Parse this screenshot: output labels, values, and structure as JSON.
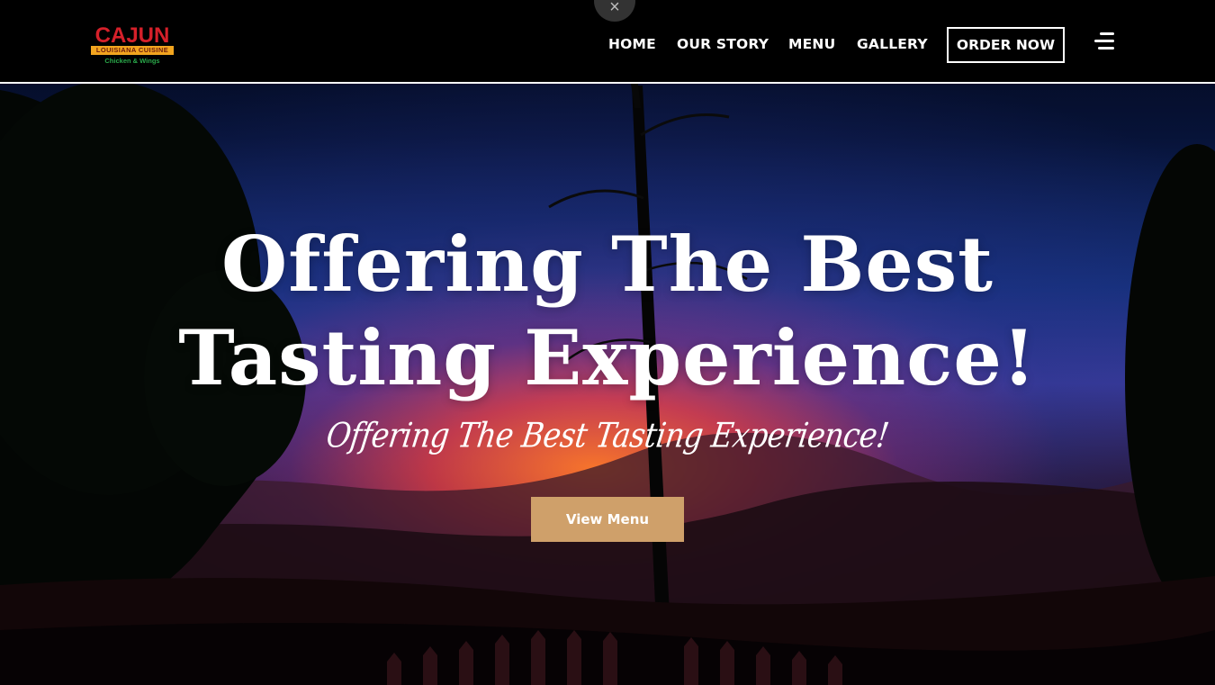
{
  "brand": {
    "name": "CAJUN",
    "ribbon": "LOUISIANA CUISINE",
    "tagline": "Chicken & Wings"
  },
  "overlay": {
    "close_icon": "×"
  },
  "nav": {
    "items": [
      {
        "label": "HOME"
      },
      {
        "label": "OUR STORY"
      },
      {
        "label": "MENU"
      },
      {
        "label": "GALLERY"
      }
    ],
    "order_label": "ORDER NOW",
    "menu_icon": "hamburger-menu-icon"
  },
  "hero": {
    "title_line1": "Offering The Best",
    "title_line2": "Tasting Experience!",
    "subtitle": "Offering The Best Tasting Experience!",
    "cta_label": "View Menu"
  },
  "colors": {
    "header_bg": "#000000",
    "logo_red": "#d6202a",
    "logo_ribbon": "#f2a51f",
    "logo_green": "#2aa84a",
    "cta_bg": "#cfa06a",
    "text": "#ffffff"
  }
}
